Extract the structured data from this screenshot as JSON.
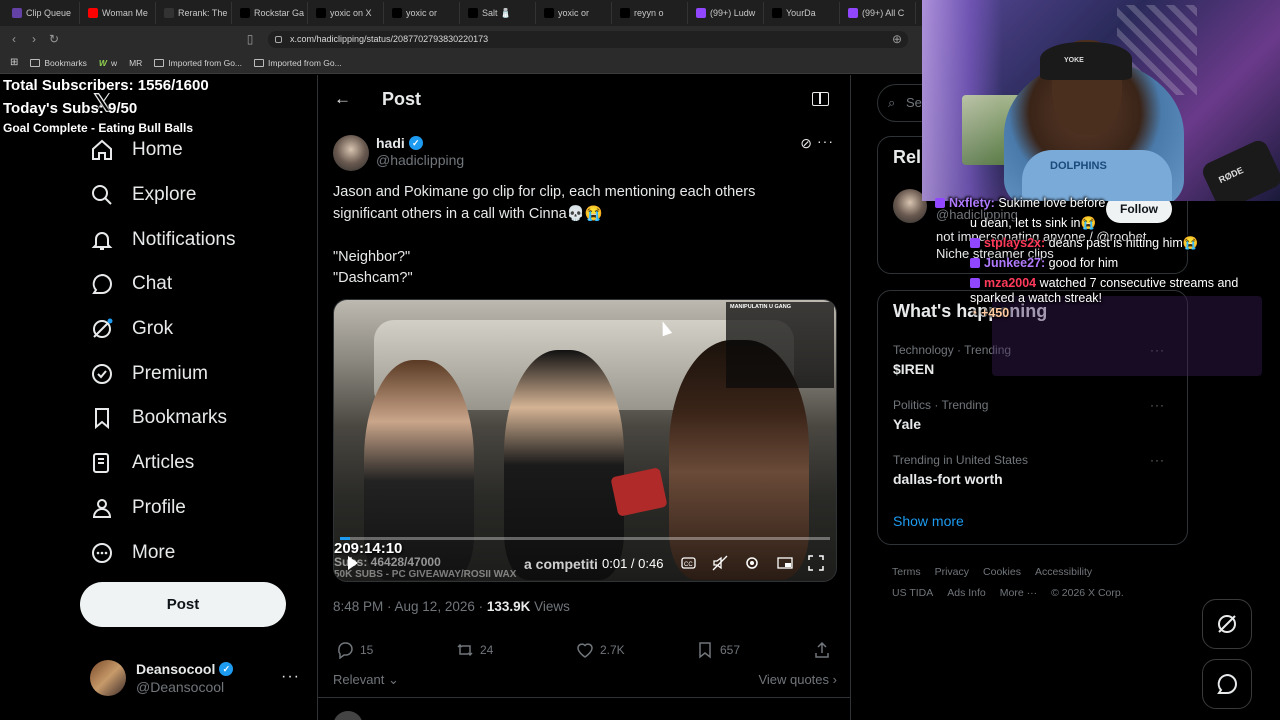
{
  "browser": {
    "tabs": [
      {
        "label": "Clip Queue",
        "color": "#6441a5"
      },
      {
        "label": "Woman Me",
        "color": "#ff0000"
      },
      {
        "label": "Rerank: The",
        "color": "#333333"
      },
      {
        "label": "Rockstar Ga",
        "color": "#000000"
      },
      {
        "label": "yoxic on X",
        "color": "#000000"
      },
      {
        "label": "yoxic or",
        "color": "#000000"
      },
      {
        "label": "Salt 🧂",
        "color": "#000000"
      },
      {
        "label": "yoxic or",
        "color": "#000000"
      },
      {
        "label": "reyyn o",
        "color": "#000000"
      },
      {
        "label": "(99+) Ludw",
        "color": "#9146ff"
      },
      {
        "label": "YourDa",
        "color": "#000000"
      },
      {
        "label": "(99+) All C",
        "color": "#9146ff"
      }
    ],
    "url": "x.com/hadiclipping/status/2087702793830220173",
    "bookmarks": [
      "Bookmarks",
      "w",
      "MR",
      "Imported from Go...",
      "Imported from Go..."
    ]
  },
  "overlay": {
    "total_subs": "Total Subscribers: 1556/1600",
    "today_subs": "Today's Subs: 9/50",
    "goal": "Goal Complete - Eating Bull Balls"
  },
  "nav": {
    "items": [
      {
        "label": "Home",
        "icon": "home-icon"
      },
      {
        "label": "Explore",
        "icon": "search-icon"
      },
      {
        "label": "Notifications",
        "icon": "bell-icon"
      },
      {
        "label": "Chat",
        "icon": "chat-icon"
      },
      {
        "label": "Grok",
        "icon": "grok-icon"
      },
      {
        "label": "Premium",
        "icon": "premium-icon"
      },
      {
        "label": "Bookmarks",
        "icon": "bookmark-icon"
      },
      {
        "label": "Articles",
        "icon": "articles-icon"
      },
      {
        "label": "Profile",
        "icon": "profile-icon"
      },
      {
        "label": "More",
        "icon": "more-icon"
      }
    ],
    "post_button": "Post",
    "account_name": "Deansocool",
    "account_handle": "@Deansocool"
  },
  "header": {
    "title": "Post"
  },
  "post": {
    "author_name": "hadi",
    "author_handle": "@hadiclipping",
    "text": "Jason and Pokimane go clip for clip, each mentioning each others significant others in a call with Cinna💀😭\n\n\"Neighbor?\"\n\"Dashcam?\"",
    "video": {
      "stream_time": "209:14:10",
      "subs_overlay": "Subs: 46428/47000",
      "promo_overlay": "50K SUBS - PC GIVEAWAY/ROSII WAX",
      "caption_overlay": "a competiti",
      "current_time": "0:01 / 0:46",
      "progress": 0.02,
      "chat_title": "MANIPULATIN U GANG"
    },
    "timestamp": "8:48 PM · Aug 12, 2026 · ",
    "views_count": "133.9K",
    "views_label": " Views",
    "replies": "15",
    "reposts": "24",
    "likes": "2.7K",
    "bookmarks": "657",
    "sort_label": "Relevant",
    "view_quotes": "View quotes"
  },
  "right": {
    "search_placeholder": "Se",
    "relevant_title": "Rel",
    "relevant_handle": "@hadiclipping",
    "follow_label": "Follow",
    "relevant_bio": "not impersonating anyone / @roobet\nNiche streamer clips",
    "happening_title": "What's happening",
    "trends": [
      {
        "category": "Technology · Trending",
        "name": "$IREN"
      },
      {
        "category": "Politics · Trending",
        "name": "Yale"
      },
      {
        "category": "Trending in United States",
        "name": "dallas-fort worth"
      }
    ],
    "show_more": "Show more",
    "footer": [
      "Terms",
      "Privacy",
      "Cookies",
      "Accessibility",
      "US TIDA",
      "Ads Info",
      "More ···",
      "© 2026 X Corp."
    ]
  },
  "webcam": {
    "cap_text": "YOKE",
    "shirt_text": "DOLPHINS",
    "mic_text": "RØDE"
  },
  "chat": {
    "l1_user": "Nxflety:",
    "l1_msg": " Sukime love before",
    "l2_msg": "u dean, let ts sink in😭",
    "l3_user": "stplays2x:",
    "l3_msg": " deans past is hitting him😭",
    "l4_user": "Junkee27:",
    "l4_msg": " good for him",
    "l5_user": "mza2004",
    "l5_msg": " watched 7 consecutive streams and sparked a watch streak!",
    "l5_points": "+450"
  }
}
